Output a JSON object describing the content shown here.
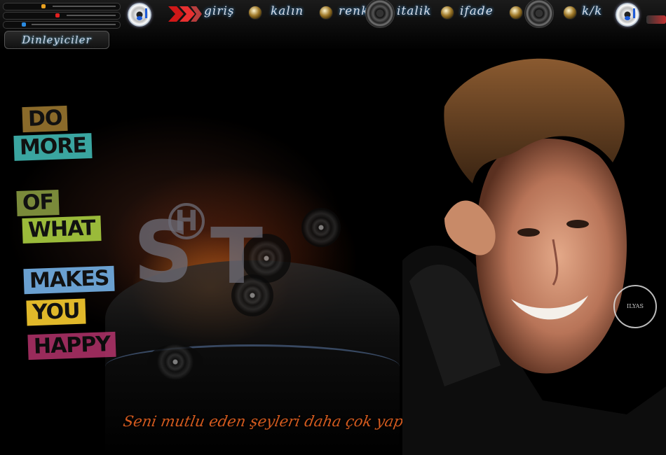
{
  "topbar": {
    "listeners_label": "Dinleyiciler",
    "menu": [
      {
        "label": "giriş",
        "icon": "chevron-arrow-icon"
      },
      {
        "label": "kalın",
        "icon": "gold-knob-icon"
      },
      {
        "label": "renk",
        "icon": "gold-knob-icon"
      },
      {
        "label": "italik",
        "icon": "speaker-icon"
      },
      {
        "label": "ifade",
        "icon": "gold-knob-icon"
      },
      {
        "label": "k/k",
        "icon": "gold-knob-icon"
      }
    ],
    "accent_color": "#d4dbe6"
  },
  "poster": {
    "lines": [
      "DO",
      "MORE",
      "OF",
      "WHAT",
      "MAKES",
      "YOU",
      "HAPPY"
    ],
    "colors": [
      "#8a6a2a",
      "#3aa5a0",
      "#7a8a3a",
      "#9aba3a",
      "#6aa0d0",
      "#e0b82a",
      "#cc3a7a"
    ]
  },
  "mascots": [
    "S",
    "H",
    "T"
  ],
  "caption": "Seni mutlu eden şeyleri daha çok yap",
  "caption_color": "#d35a1e",
  "seal_text": "ILYAS"
}
